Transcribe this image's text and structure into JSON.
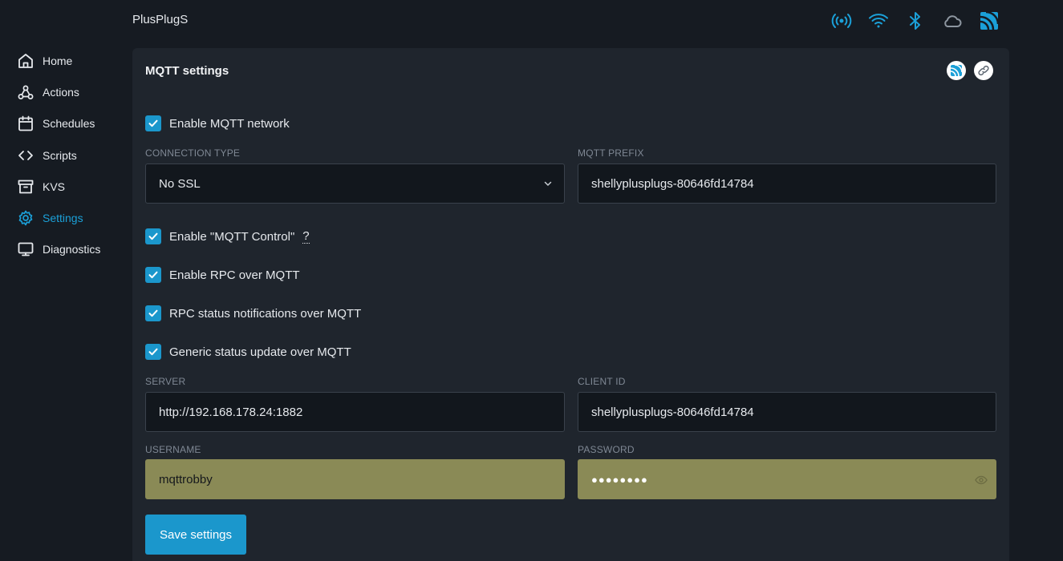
{
  "header": {
    "title": "PlusPlugS"
  },
  "status_icons": [
    "broadcast-icon",
    "wifi-icon",
    "bluetooth-icon",
    "cloud-icon",
    "mqtt-icon"
  ],
  "sidebar": {
    "items": [
      {
        "label": "Home",
        "icon": "home-icon",
        "active": false
      },
      {
        "label": "Actions",
        "icon": "webhook-icon",
        "active": false
      },
      {
        "label": "Schedules",
        "icon": "calendar-icon",
        "active": false
      },
      {
        "label": "Scripts",
        "icon": "code-icon",
        "active": false
      },
      {
        "label": "KVS",
        "icon": "archive-icon",
        "active": false
      },
      {
        "label": "Settings",
        "icon": "gear-icon",
        "active": true
      },
      {
        "label": "Diagnostics",
        "icon": "monitor-icon",
        "active": false
      }
    ]
  },
  "card": {
    "title": "MQTT settings",
    "enable_mqtt": {
      "label": "Enable MQTT network",
      "checked": true
    },
    "connection_type": {
      "label": "CONNECTION TYPE",
      "value": "No SSL"
    },
    "mqtt_prefix": {
      "label": "MQTT PREFIX",
      "value": "shellyplusplugs-80646fd14784"
    },
    "enable_mqtt_control": {
      "label": "Enable \"MQTT Control\"",
      "help": "?",
      "checked": true
    },
    "enable_rpc": {
      "label": "Enable RPC over MQTT",
      "checked": true
    },
    "rpc_status": {
      "label": "RPC status notifications over MQTT",
      "checked": true
    },
    "generic_status": {
      "label": "Generic status update over MQTT",
      "checked": true
    },
    "server": {
      "label": "SERVER",
      "value": "http://192.168.178.24:1882"
    },
    "client_id": {
      "label": "CLIENT ID",
      "value": "shellyplusplugs-80646fd14784"
    },
    "username": {
      "label": "USERNAME",
      "value": "mqttrobby"
    },
    "password": {
      "label": "PASSWORD",
      "value": "●●●●●●●●"
    },
    "save_label": "Save settings"
  },
  "colors": {
    "accent": "#1b97cc",
    "background": "#161b22",
    "card": "#1f252d",
    "autofill": "#8a8a56"
  }
}
